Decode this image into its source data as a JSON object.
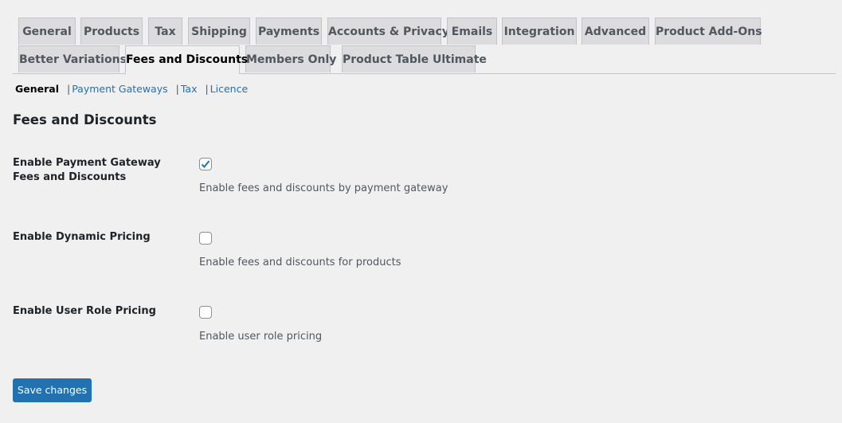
{
  "tabs": [
    {
      "label": "General",
      "active": false
    },
    {
      "label": "Products",
      "active": false
    },
    {
      "label": "Tax",
      "active": false
    },
    {
      "label": "Shipping",
      "active": false
    },
    {
      "label": "Payments",
      "active": false
    },
    {
      "label": "Accounts & Privacy",
      "active": false
    },
    {
      "label": "Emails",
      "active": false
    },
    {
      "label": "Integration",
      "active": false
    },
    {
      "label": "Advanced",
      "active": false
    },
    {
      "label": "Product Add-Ons",
      "active": false
    },
    {
      "label": "Better Variations",
      "active": false
    },
    {
      "label": "Fees and Discounts",
      "active": true
    },
    {
      "label": "Members Only",
      "active": false
    },
    {
      "label": "Product Table Ultimate",
      "active": false
    }
  ],
  "subnav": {
    "current": "General",
    "links": [
      "Payment Gateways",
      "Tax",
      "Licence"
    ],
    "separator": "|"
  },
  "section_title": "Fees and Discounts",
  "settings": [
    {
      "label": "Enable Payment Gateway Fees and Discounts",
      "checked": true,
      "description": "Enable fees and discounts by payment gateway"
    },
    {
      "label": "Enable Dynamic Pricing",
      "checked": false,
      "description": "Enable fees and discounts for products"
    },
    {
      "label": "Enable User Role Pricing",
      "checked": false,
      "description": "Enable user role pricing"
    }
  ],
  "save_label": "Save changes",
  "colors": {
    "accent": "#2271b1",
    "background": "#f0f0f1",
    "tab_bg": "#dcdcde"
  }
}
